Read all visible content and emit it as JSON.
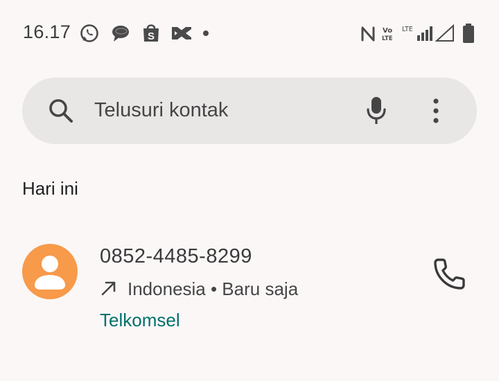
{
  "status_bar": {
    "time": "16.17",
    "notification_icons": [
      "whatsapp-icon",
      "chat-bubble-icon",
      "shopee-bag-icon",
      "capcut-icon",
      "more-notifications-dot-icon"
    ],
    "system_icons": [
      "nfc-icon",
      "volte-icon",
      "lte-signal-icon",
      "signal-empty-icon",
      "battery-icon"
    ]
  },
  "search": {
    "placeholder": "Telusuri kontak"
  },
  "section": {
    "title": "Hari ini"
  },
  "call_log": [
    {
      "number": "0852-4485-8299",
      "direction_icon": "outgoing-call-arrow-icon",
      "meta": "Indonesia • Baru saja",
      "carrier": "Telkomsel",
      "avatar_color": "#f79a4a"
    }
  ],
  "colors": {
    "background": "#fbf7f7",
    "search_bg": "#e9e6e6",
    "carrier_text": "#00706b",
    "avatar": "#f79a4a"
  }
}
